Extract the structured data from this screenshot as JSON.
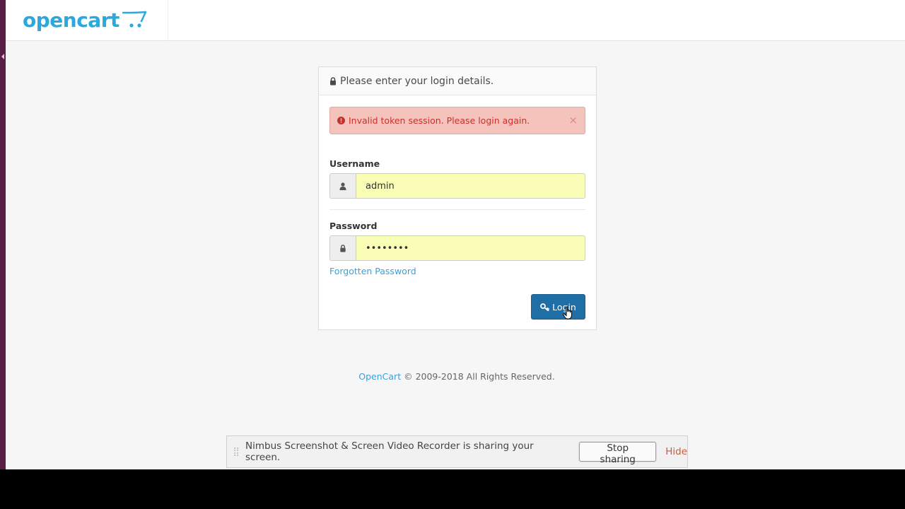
{
  "header": {
    "logo_text": "opencart"
  },
  "login_panel": {
    "heading": "Please enter your login details.",
    "alert": {
      "message": "Invalid token session. Please login again.",
      "close_glyph": "×"
    },
    "username": {
      "label": "Username",
      "value": "admin"
    },
    "password": {
      "label": "Password",
      "value": "••••••••"
    },
    "forgot_link": "Forgotten Password",
    "login_button": "Login"
  },
  "footer": {
    "link_text": "OpenCart",
    "rest_text": "© 2009-2018 All Rights Reserved."
  },
  "share_bar": {
    "message": "Nimbus Screenshot & Screen Video Recorder is sharing your screen.",
    "stop_button": "Stop sharing",
    "hide_link": "Hide"
  },
  "colors": {
    "brand": "#2ba8dd",
    "primary_button": "#1f6fa6",
    "alert_bg": "#f4c3bb",
    "alert_text": "#c8302c",
    "autofill_bg": "#fafdb6",
    "link": "#3e9fd4"
  },
  "icons": {
    "logo": "cart-icon",
    "heading": "lock-icon",
    "alert": "exclamation-circle-icon",
    "username": "user-icon",
    "password": "lock-icon",
    "login": "key-icon"
  }
}
